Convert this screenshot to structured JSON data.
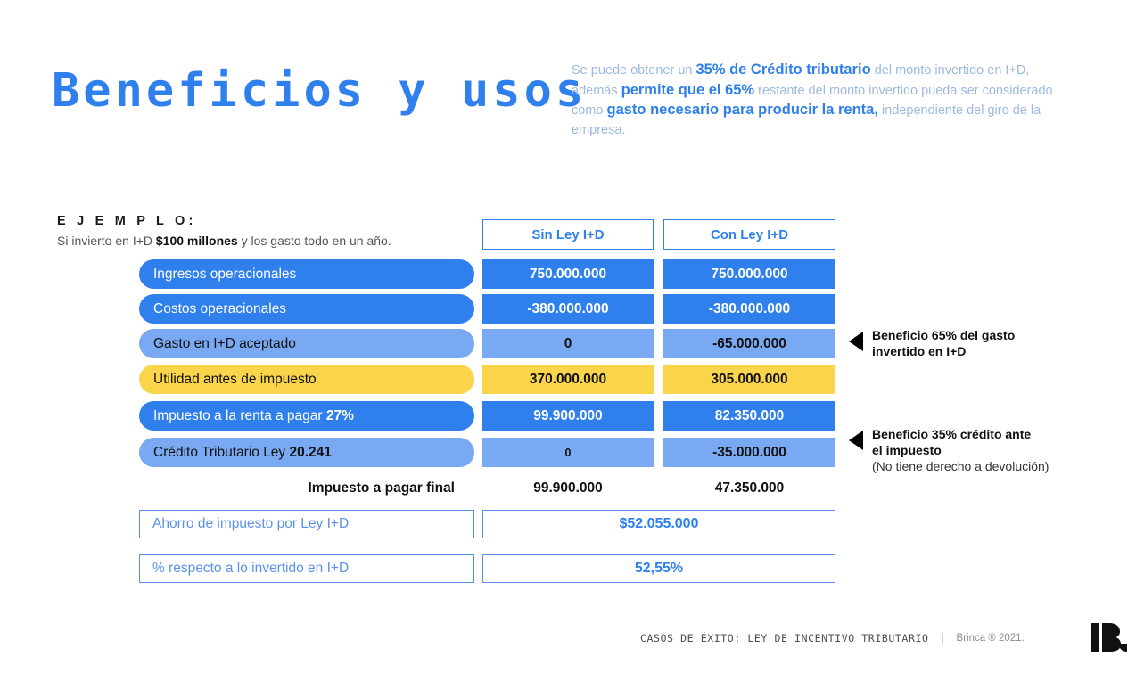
{
  "header": {
    "title": "Beneficios y usos",
    "intro": {
      "p1": "Se puede obtener un ",
      "b1": "35% de Crédito tributario",
      "p2": " del monto invertido en I+D, además ",
      "b2": "permite que el 65%",
      "p3": " restante del monto invertido pueda ser considerado como ",
      "b3": "gasto necesario para producir la renta,",
      "p4": " independiente del giro de la empresa."
    }
  },
  "example": {
    "heading": "E J E M P L O:",
    "sub_pre": "Si invierto en I+D ",
    "sub_bold": "$100 millones",
    "sub_post": " y los gasto todo en un año."
  },
  "table": {
    "columns": [
      "Sin Ley I+D",
      "Con Ley I+D"
    ],
    "rows": [
      {
        "label": "Ingresos operacionales",
        "label_bold": "",
        "sin": "750.000.000",
        "con": "750.000.000",
        "style": "c-blue"
      },
      {
        "label": "Costos operacionales",
        "label_bold": "",
        "sin": "-380.000.000",
        "con": "-380.000.000",
        "style": "c-blue"
      },
      {
        "label": "Gasto en I+D aceptado",
        "label_bold": "",
        "sin": "0",
        "con": "-65.000.000",
        "style": "c-lblue"
      },
      {
        "label": "Utilidad antes de impuesto",
        "label_bold": "",
        "sin": "370.000.000",
        "con": "305.000.000",
        "style": "c-yellow"
      },
      {
        "label": "Impuesto a la renta a pagar ",
        "label_bold": "27%",
        "sin": "99.900.000",
        "con": "82.350.000",
        "style": "c-blue"
      },
      {
        "label": "Crédito Tributario Ley ",
        "label_bold": "20.241",
        "sin": "0",
        "con": "-35.000.000",
        "style": "c-lblue"
      }
    ],
    "total": {
      "label": "Impuesto a pagar final",
      "sin": "99.900.000",
      "con": "47.350.000"
    },
    "summary": [
      {
        "label": "Ahorro de impuesto por Ley I+D",
        "value": "$52.055.000"
      },
      {
        "label": "% respecto a lo invertido en I+D",
        "value": "52,55%"
      }
    ]
  },
  "annotations": [
    {
      "line1": "Beneficio 65% del gasto",
      "line2": "invertido en I+D",
      "note": ""
    },
    {
      "line1": "Beneficio 35% crédito ante",
      "line2": "el impuesto",
      "note": "(No tiene derecho a devolución)"
    }
  ],
  "footer": {
    "title": "CASOS DE ÉXITO: LEY DE INCENTIVO TRIBUTARIO",
    "separator": "|",
    "credit": "Brinca ® 2021."
  },
  "colors": {
    "accent_blue": "#2f80ed",
    "light_blue": "#79a9f2",
    "yellow": "#fad44b",
    "muted_blue": "#9db9e0",
    "border_blue": "#5a92e8"
  }
}
